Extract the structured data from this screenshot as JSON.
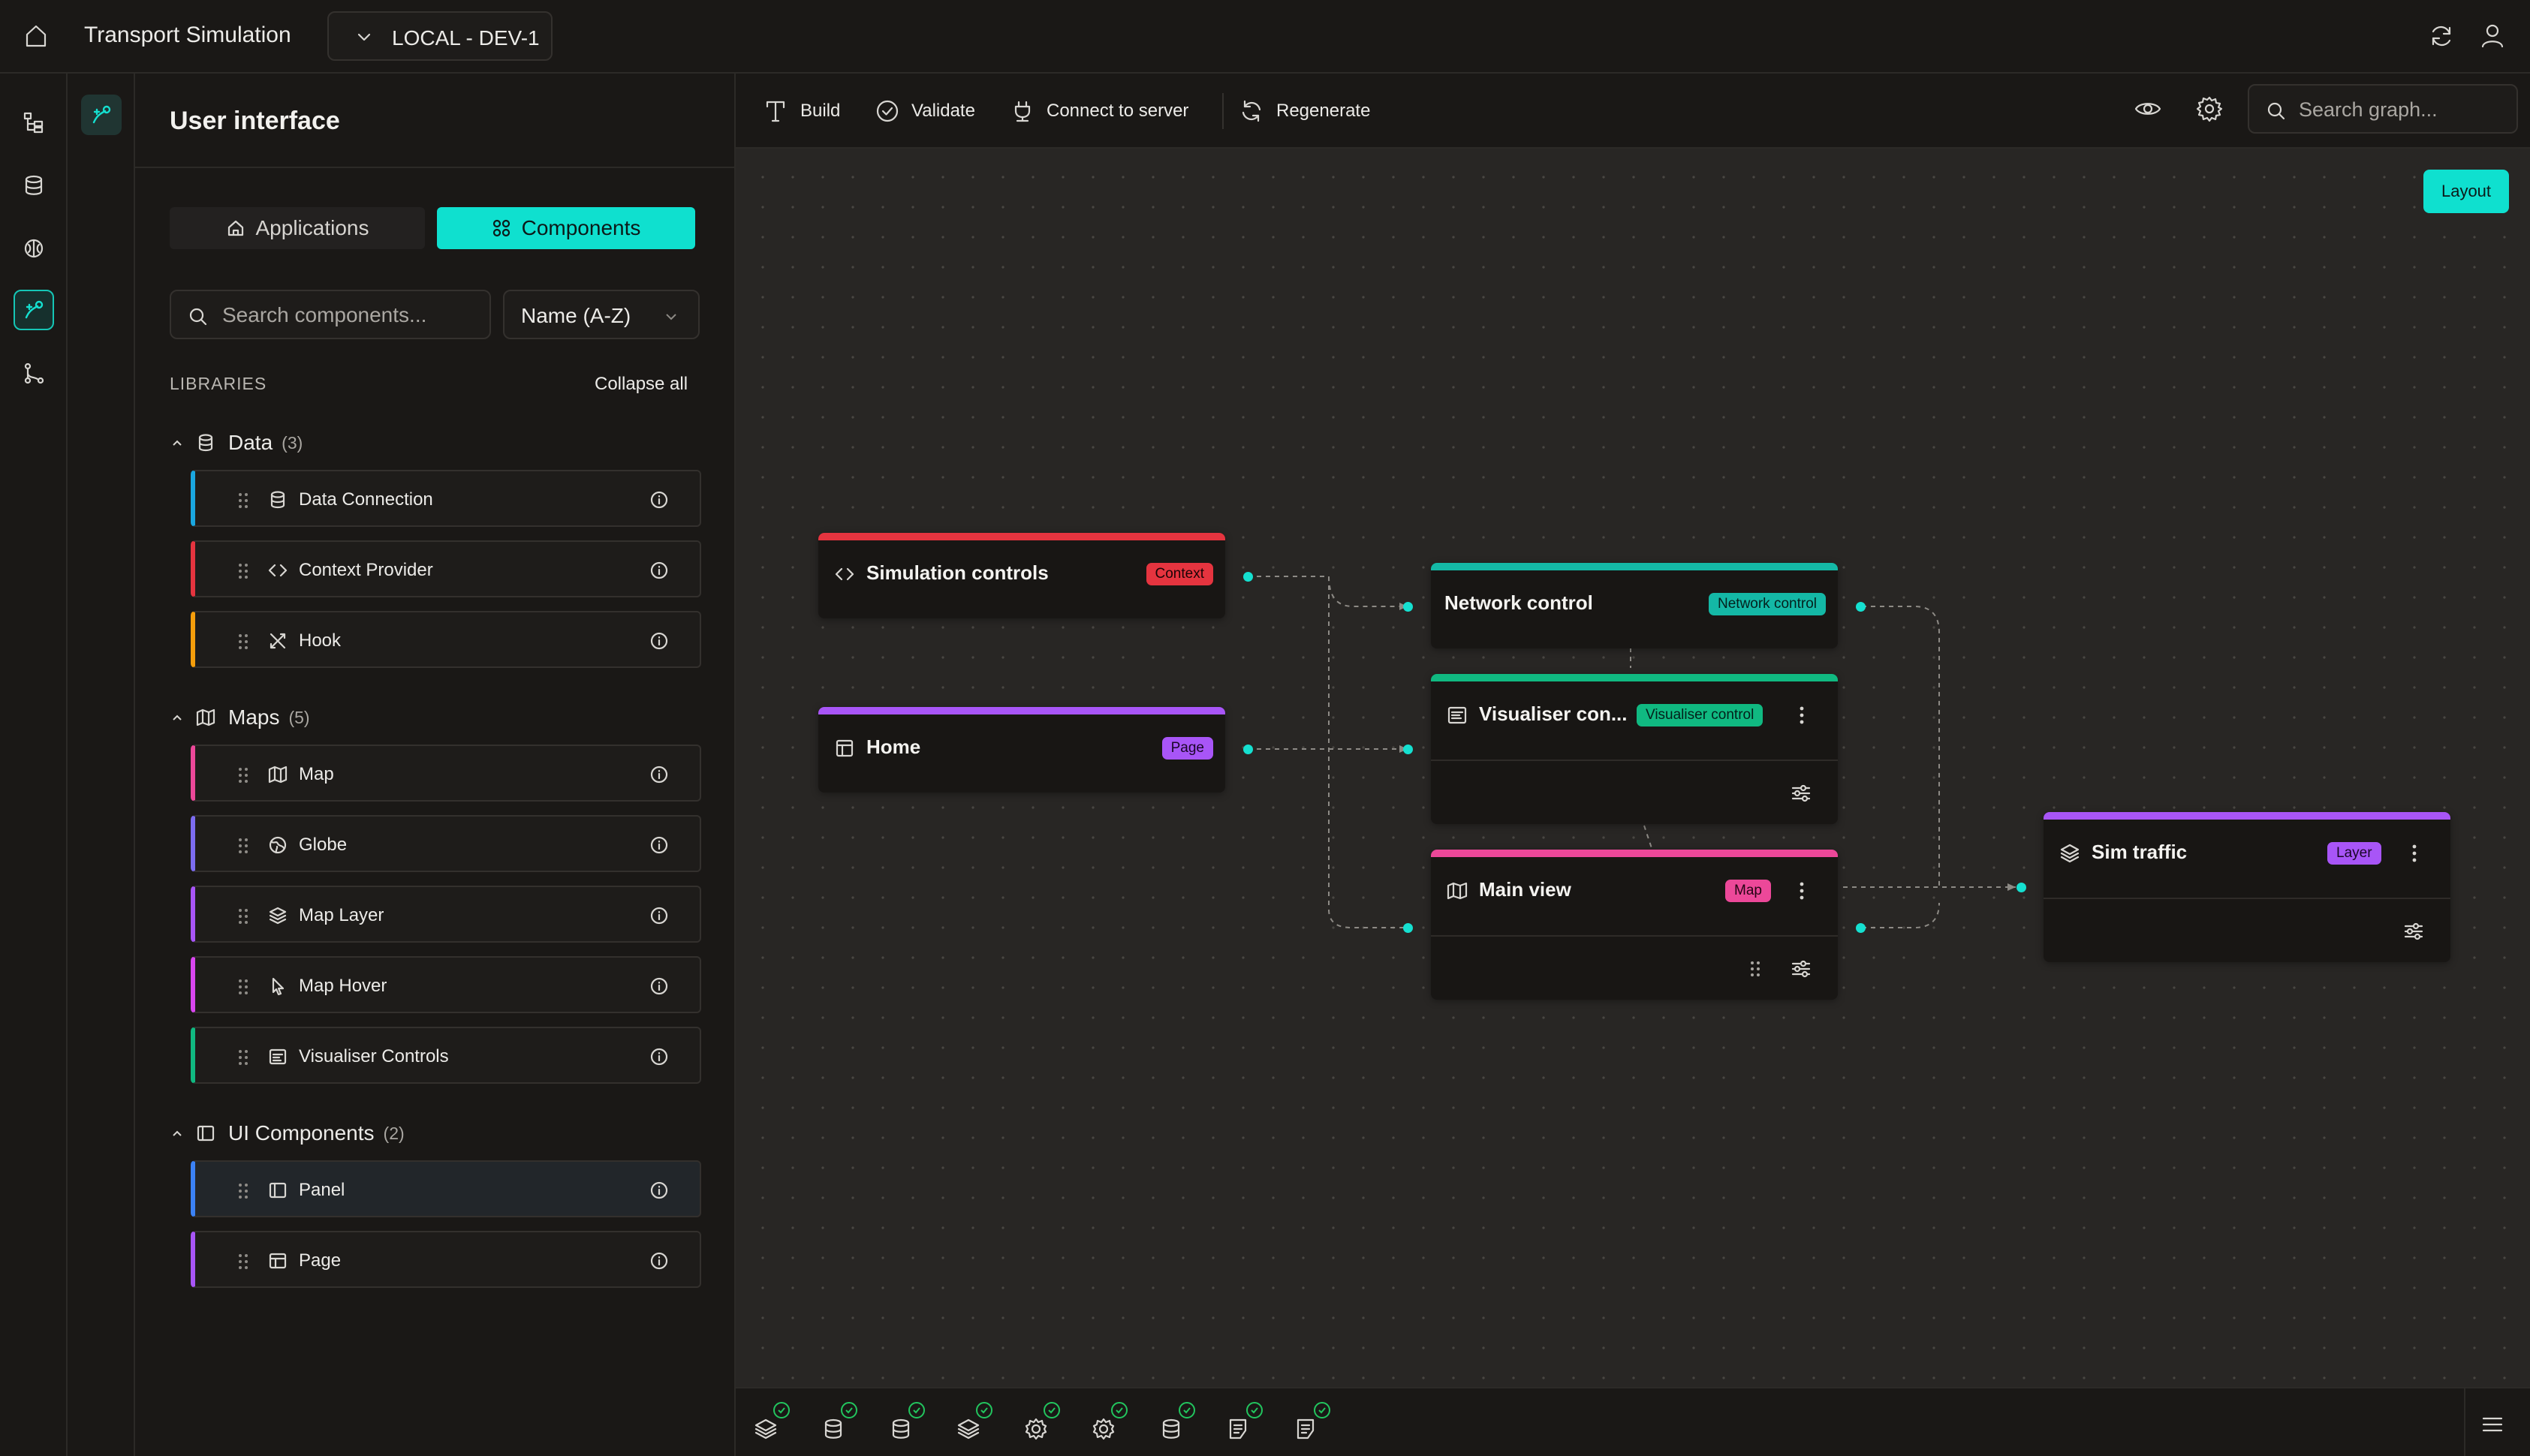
{
  "topbar": {
    "app_title": "Transport Simulation",
    "environment": "LOCAL - DEV-1"
  },
  "panel": {
    "title": "User interface",
    "tabs": {
      "applications": "Applications",
      "components": "Components"
    },
    "search_placeholder": "Search components...",
    "sort_value": "Name (A-Z)",
    "libraries_label": "LIBRARIES",
    "collapse_all": "Collapse all",
    "groups": [
      {
        "name": "Data",
        "count": "(3)",
        "icon": "database-icon",
        "items": [
          {
            "label": "Data Connection",
            "icon": "database-icon",
            "color": "#1aa7e0"
          },
          {
            "label": "Context Provider",
            "icon": "code-icon",
            "color": "#e5343f"
          },
          {
            "label": "Hook",
            "icon": "tools-icon",
            "color": "#f59e0b"
          }
        ]
      },
      {
        "name": "Maps",
        "count": "(5)",
        "icon": "map-icon",
        "items": [
          {
            "label": "Map",
            "icon": "map-icon",
            "color": "#ec4899"
          },
          {
            "label": "Globe",
            "icon": "globe-icon",
            "color": "#7c6cf0"
          },
          {
            "label": "Map Layer",
            "icon": "layers-icon",
            "color": "#a855f7"
          },
          {
            "label": "Map Hover",
            "icon": "pointer-icon",
            "color": "#d946ef"
          },
          {
            "label": "Visualiser Controls",
            "icon": "controls-icon",
            "color": "#10b981"
          }
        ]
      },
      {
        "name": "UI Components",
        "count": "(2)",
        "icon": "panel-icon",
        "items": [
          {
            "label": "Panel",
            "icon": "panel-icon",
            "color": "#3b82f6"
          },
          {
            "label": "Page",
            "icon": "page-icon",
            "color": "#a855f7"
          }
        ]
      }
    ]
  },
  "toolbar": {
    "build": "Build",
    "validate": "Validate",
    "connect": "Connect to server",
    "regenerate": "Regenerate",
    "search_placeholder": "Search graph..."
  },
  "canvas": {
    "layout_button": "Layout",
    "nodes": {
      "simulation_controls": {
        "title": "Simulation controls",
        "badge": "Context",
        "color": "#e5343f"
      },
      "home": {
        "title": "Home",
        "badge": "Page",
        "color": "#a855f7"
      },
      "network_control": {
        "title": "Network control",
        "badge": "Network control",
        "color": "#14b8a6"
      },
      "visualiser_controls": {
        "title": "Visualiser con...",
        "badge": "Visualiser control",
        "color": "#10b981"
      },
      "main_view": {
        "title": "Main view",
        "badge": "Map",
        "color": "#ec4899"
      },
      "sim_traffic": {
        "title": "Sim traffic",
        "badge": "Layer",
        "color": "#a855f7"
      }
    }
  },
  "statusbar": {
    "items": [
      "layers-icon",
      "database-icon",
      "database-icon",
      "layers-icon",
      "gear-icon",
      "gear-icon",
      "database-icon",
      "document-icon",
      "document-icon"
    ],
    "status": "valid"
  }
}
